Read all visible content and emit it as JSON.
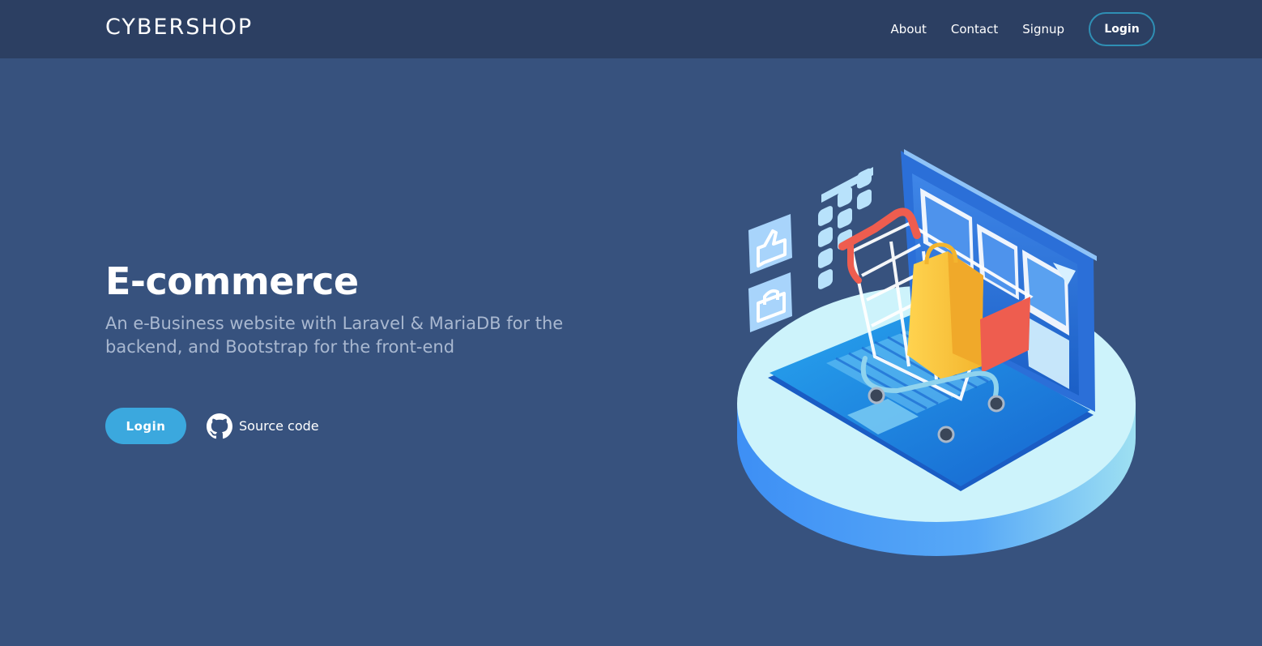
{
  "navbar": {
    "brand": "CYBERSHOP",
    "links": [
      {
        "label": "About"
      },
      {
        "label": "Contact"
      },
      {
        "label": "Signup"
      }
    ],
    "login_label": "Login"
  },
  "hero": {
    "title": "E-commerce",
    "subtitle": "An e-Business website with Laravel & MariaDB for the backend, and Bootstrap for the front-end",
    "login_label": "Login",
    "source_label": "Source code",
    "source_icon": "github-icon"
  },
  "illustration": {
    "icon": "laptop-shopping-cart-illustration"
  },
  "colors": {
    "background": "#37527e",
    "navbar": "#2c3f62",
    "accent": "#3ba8de",
    "nav_login_border": "#2f8fb4",
    "subtitle": "#a9b8d0"
  }
}
